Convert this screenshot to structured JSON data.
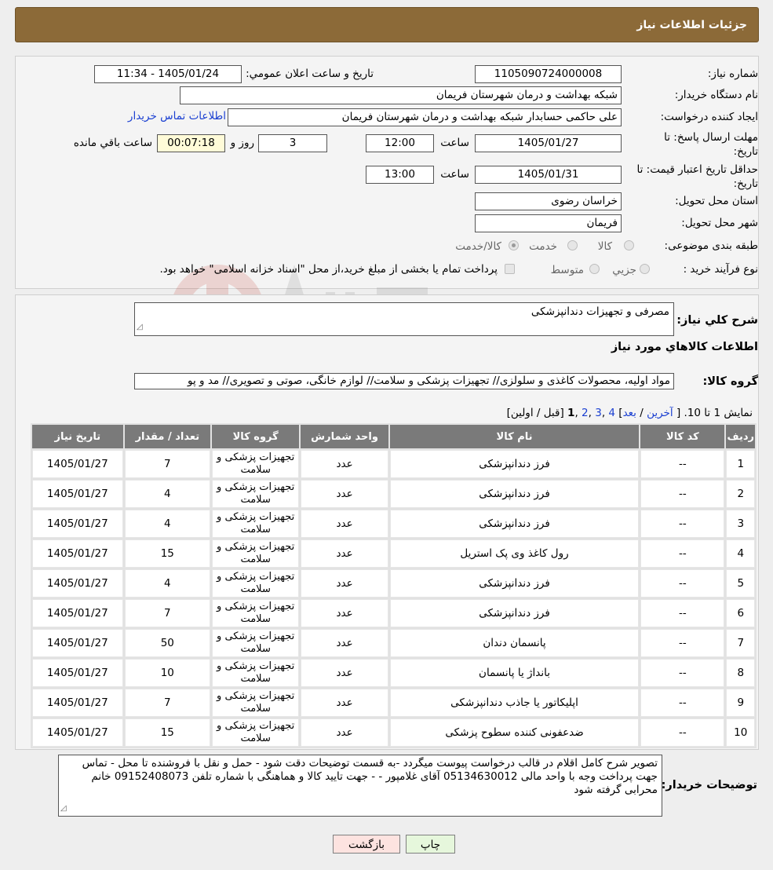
{
  "header": {
    "title": "جزئيات اطلاعات نياز"
  },
  "info": {
    "need_number_label": "شماره نياز:",
    "need_number": "1105090724000008",
    "announce_label": "تاريخ و ساعت اعلان عمومي:",
    "announce_value": "1405/01/24 - 11:34",
    "buyer_label": "نام دستگاه خريدار:",
    "buyer_value": "شبکه بهداشت و درمان شهرستان فریمان",
    "creator_label": "ايجاد کننده درخواست:",
    "creator_value": "علی حاکمی حسابدار شبکه بهداشت و درمان شهرستان فریمان",
    "contact_link": "اطلاعات تماس خريدار",
    "deadline_label_1": "مهلت ارسال پاسخ: تا",
    "deadline_label_2": "تاريخ:",
    "deadline_date": "1405/01/27",
    "time_label": "ساعت",
    "deadline_time": "12:00",
    "days_value": "3",
    "days_label": "روز و",
    "remaining_value": "00:07:18",
    "remaining_label": "ساعت باقي مانده",
    "validity_label_1": "حداقل تاريخ اعتبار قيمت: تا",
    "validity_label_2": "تاريخ:",
    "validity_date": "1405/01/31",
    "validity_time": "13:00",
    "province_label": "استان محل تحويل:",
    "province_value": "خراسان رضوی",
    "city_label": "شهر محل تحويل:",
    "city_value": "فریمان",
    "category_label": "طبقه بندی موضوعی:",
    "category_options": [
      "کالا",
      "خدمت",
      "کالا/خدمت"
    ],
    "process_label": "نوع فرآيند خريد :",
    "process_options": [
      "جزيي",
      "متوسط"
    ],
    "process_note": "پرداخت تمام يا بخشی از مبلغ خريد،از محل \"اسناد خزانه اسلامی\" خواهد بود."
  },
  "details": {
    "summary_label": "شرح کلي نياز:",
    "summary_value": "مصرفی و تجهیزات دندانپزشکی",
    "goods_info_title": "اطلاعات کالاهاي مورد نياز",
    "group_label": "گروه کالا:",
    "group_value": "مواد اولیه، محصولات کاغذی و سلولزی// تجهیزات پزشکی و سلامت// لوازم خانگی، صوتی و تصویری// مد و پو",
    "pager": {
      "show_text": "نمايش 1 تا 10.",
      "open": "[",
      "last": "آخرين",
      "next": "بعد",
      "p4": "4",
      "p3": "3",
      "p2": "2",
      "p1": "1",
      "prev_first": "[قبل / اولين]"
    },
    "table": {
      "headers": [
        "رديف",
        "کد کالا",
        "نام کالا",
        "واحد شمارش",
        "گروه کالا",
        "تعداد / مقدار",
        "تاريخ نياز"
      ],
      "rows": [
        {
          "row": "1",
          "code": "--",
          "name": "فرز دندانپزشکی",
          "unit": "عدد",
          "group": "تجهیزات پزشکی و سلامت",
          "qty": "7",
          "date": "1405/01/27"
        },
        {
          "row": "2",
          "code": "--",
          "name": "فرز دندانپزشکی",
          "unit": "عدد",
          "group": "تجهیزات پزشکی و سلامت",
          "qty": "4",
          "date": "1405/01/27"
        },
        {
          "row": "3",
          "code": "--",
          "name": "فرز دندانپزشکی",
          "unit": "عدد",
          "group": "تجهیزات پزشکی و سلامت",
          "qty": "4",
          "date": "1405/01/27"
        },
        {
          "row": "4",
          "code": "--",
          "name": "رول کاغذ وی پک استریل",
          "unit": "عدد",
          "group": "تجهیزات پزشکی و سلامت",
          "qty": "15",
          "date": "1405/01/27"
        },
        {
          "row": "5",
          "code": "--",
          "name": "فرز دندانپزشکی",
          "unit": "عدد",
          "group": "تجهیزات پزشکی و سلامت",
          "qty": "4",
          "date": "1405/01/27"
        },
        {
          "row": "6",
          "code": "--",
          "name": "فرز دندانپزشکی",
          "unit": "عدد",
          "group": "تجهیزات پزشکی و سلامت",
          "qty": "7",
          "date": "1405/01/27"
        },
        {
          "row": "7",
          "code": "--",
          "name": "پانسمان دندان",
          "unit": "عدد",
          "group": "تجهیزات پزشکی و سلامت",
          "qty": "50",
          "date": "1405/01/27"
        },
        {
          "row": "8",
          "code": "--",
          "name": "بانداژ یا پانسمان",
          "unit": "عدد",
          "group": "تجهیزات پزشکی و سلامت",
          "qty": "10",
          "date": "1405/01/27"
        },
        {
          "row": "9",
          "code": "--",
          "name": "اپلیکاتور یا جاذب دندانپزشکی",
          "unit": "عدد",
          "group": "تجهیزات پزشکی و سلامت",
          "qty": "7",
          "date": "1405/01/27"
        },
        {
          "row": "10",
          "code": "--",
          "name": "ضدعفونی کننده سطوح پزشکی",
          "unit": "عدد",
          "group": "تجهیزات پزشکی و سلامت",
          "qty": "15",
          "date": "1405/01/27"
        }
      ]
    },
    "buyer_notes_label": "توضيحات خريدار:",
    "buyer_notes_value": "تصویر شرح کامل اقلام در قالب درخواست پیوست میگردد -به قسمت توضیحات دقت شود - حمل و نقل با فروشنده تا محل - تماس جهت پرداخت وجه با واحد مالی 05134630012 آقای غلامپور  -  - جهت تایید کالا و هماهنگی با شماره تلفن 09152408073 خانم محرابی گرفته شود"
  },
  "buttons": {
    "print": "چاپ",
    "back": "بازگشت"
  },
  "colors": {
    "header": "#8c6a38",
    "table_header": "#7a7a7a",
    "link": "#1a3fd1",
    "back_button": "#fde3e0",
    "print_button": "#e6f7dc"
  }
}
